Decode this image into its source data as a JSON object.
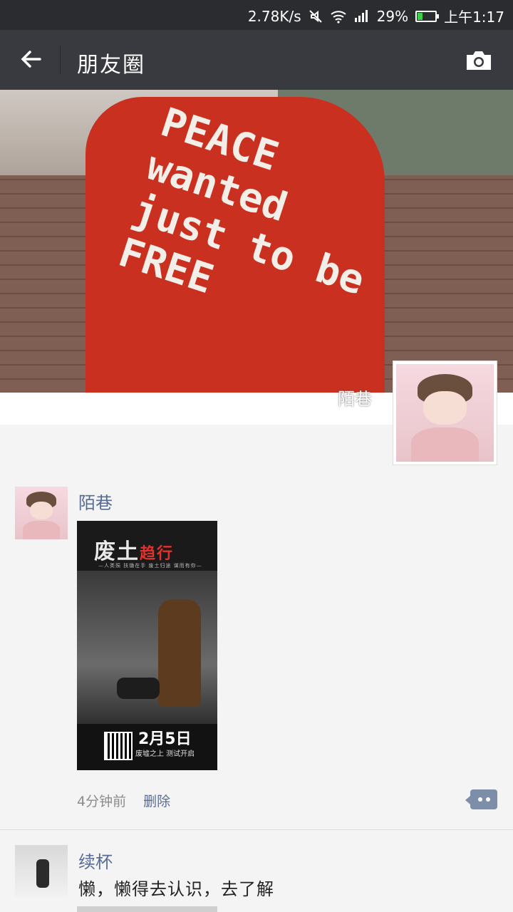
{
  "status_bar": {
    "speed": "2.78K/s",
    "battery": "29%",
    "battery_level": 0.29,
    "time": "上午1:17",
    "icons": [
      "mute-icon",
      "wifi-icon",
      "signal-icon",
      "battery-icon"
    ]
  },
  "navbar": {
    "back_icon": "back-arrow-icon",
    "title": "朋友圈",
    "camera_icon": "camera-icon"
  },
  "cover": {
    "jacket_lines": [
      "PEACE",
      "wanted",
      "just to be",
      "FREE"
    ],
    "user_name": "陌巷"
  },
  "posts": [
    {
      "name": "陌巷",
      "poster": {
        "title_main": "废土",
        "title_accent": "趋行",
        "subtitle": "—人类殒 扶锄在手 废土归途 谋而有你—",
        "date": "2月5日",
        "note": "废墟之上 测试开启"
      },
      "time": "4分钟前",
      "delete_label": "删除",
      "comment_icon": "comment-dots-icon"
    },
    {
      "name": "续杯",
      "text": "懒，懒得去认识，去了解"
    }
  ],
  "colors": {
    "status_bg": "#2a2c30",
    "nav_bg": "#393a3f",
    "link": "#576b95",
    "page_bg": "#f4f4f4"
  }
}
